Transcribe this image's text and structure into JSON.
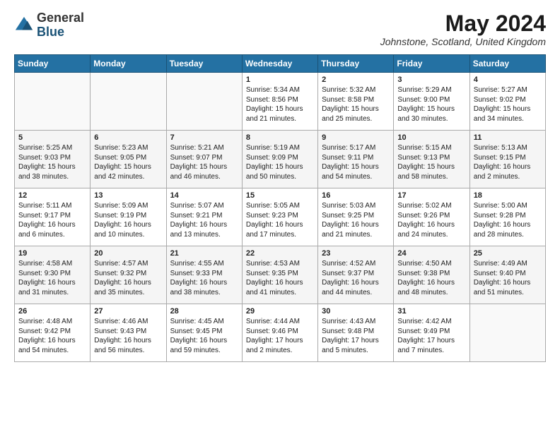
{
  "logo": {
    "general": "General",
    "blue": "Blue"
  },
  "header": {
    "month_year": "May 2024",
    "location": "Johnstone, Scotland, United Kingdom"
  },
  "days_of_week": [
    "Sunday",
    "Monday",
    "Tuesday",
    "Wednesday",
    "Thursday",
    "Friday",
    "Saturday"
  ],
  "weeks": [
    [
      {
        "day": "",
        "info": ""
      },
      {
        "day": "",
        "info": ""
      },
      {
        "day": "",
        "info": ""
      },
      {
        "day": "1",
        "info": "Sunrise: 5:34 AM\nSunset: 8:56 PM\nDaylight: 15 hours\nand 21 minutes."
      },
      {
        "day": "2",
        "info": "Sunrise: 5:32 AM\nSunset: 8:58 PM\nDaylight: 15 hours\nand 25 minutes."
      },
      {
        "day": "3",
        "info": "Sunrise: 5:29 AM\nSunset: 9:00 PM\nDaylight: 15 hours\nand 30 minutes."
      },
      {
        "day": "4",
        "info": "Sunrise: 5:27 AM\nSunset: 9:02 PM\nDaylight: 15 hours\nand 34 minutes."
      }
    ],
    [
      {
        "day": "5",
        "info": "Sunrise: 5:25 AM\nSunset: 9:03 PM\nDaylight: 15 hours\nand 38 minutes."
      },
      {
        "day": "6",
        "info": "Sunrise: 5:23 AM\nSunset: 9:05 PM\nDaylight: 15 hours\nand 42 minutes."
      },
      {
        "day": "7",
        "info": "Sunrise: 5:21 AM\nSunset: 9:07 PM\nDaylight: 15 hours\nand 46 minutes."
      },
      {
        "day": "8",
        "info": "Sunrise: 5:19 AM\nSunset: 9:09 PM\nDaylight: 15 hours\nand 50 minutes."
      },
      {
        "day": "9",
        "info": "Sunrise: 5:17 AM\nSunset: 9:11 PM\nDaylight: 15 hours\nand 54 minutes."
      },
      {
        "day": "10",
        "info": "Sunrise: 5:15 AM\nSunset: 9:13 PM\nDaylight: 15 hours\nand 58 minutes."
      },
      {
        "day": "11",
        "info": "Sunrise: 5:13 AM\nSunset: 9:15 PM\nDaylight: 16 hours\nand 2 minutes."
      }
    ],
    [
      {
        "day": "12",
        "info": "Sunrise: 5:11 AM\nSunset: 9:17 PM\nDaylight: 16 hours\nand 6 minutes."
      },
      {
        "day": "13",
        "info": "Sunrise: 5:09 AM\nSunset: 9:19 PM\nDaylight: 16 hours\nand 10 minutes."
      },
      {
        "day": "14",
        "info": "Sunrise: 5:07 AM\nSunset: 9:21 PM\nDaylight: 16 hours\nand 13 minutes."
      },
      {
        "day": "15",
        "info": "Sunrise: 5:05 AM\nSunset: 9:23 PM\nDaylight: 16 hours\nand 17 minutes."
      },
      {
        "day": "16",
        "info": "Sunrise: 5:03 AM\nSunset: 9:25 PM\nDaylight: 16 hours\nand 21 minutes."
      },
      {
        "day": "17",
        "info": "Sunrise: 5:02 AM\nSunset: 9:26 PM\nDaylight: 16 hours\nand 24 minutes."
      },
      {
        "day": "18",
        "info": "Sunrise: 5:00 AM\nSunset: 9:28 PM\nDaylight: 16 hours\nand 28 minutes."
      }
    ],
    [
      {
        "day": "19",
        "info": "Sunrise: 4:58 AM\nSunset: 9:30 PM\nDaylight: 16 hours\nand 31 minutes."
      },
      {
        "day": "20",
        "info": "Sunrise: 4:57 AM\nSunset: 9:32 PM\nDaylight: 16 hours\nand 35 minutes."
      },
      {
        "day": "21",
        "info": "Sunrise: 4:55 AM\nSunset: 9:33 PM\nDaylight: 16 hours\nand 38 minutes."
      },
      {
        "day": "22",
        "info": "Sunrise: 4:53 AM\nSunset: 9:35 PM\nDaylight: 16 hours\nand 41 minutes."
      },
      {
        "day": "23",
        "info": "Sunrise: 4:52 AM\nSunset: 9:37 PM\nDaylight: 16 hours\nand 44 minutes."
      },
      {
        "day": "24",
        "info": "Sunrise: 4:50 AM\nSunset: 9:38 PM\nDaylight: 16 hours\nand 48 minutes."
      },
      {
        "day": "25",
        "info": "Sunrise: 4:49 AM\nSunset: 9:40 PM\nDaylight: 16 hours\nand 51 minutes."
      }
    ],
    [
      {
        "day": "26",
        "info": "Sunrise: 4:48 AM\nSunset: 9:42 PM\nDaylight: 16 hours\nand 54 minutes."
      },
      {
        "day": "27",
        "info": "Sunrise: 4:46 AM\nSunset: 9:43 PM\nDaylight: 16 hours\nand 56 minutes."
      },
      {
        "day": "28",
        "info": "Sunrise: 4:45 AM\nSunset: 9:45 PM\nDaylight: 16 hours\nand 59 minutes."
      },
      {
        "day": "29",
        "info": "Sunrise: 4:44 AM\nSunset: 9:46 PM\nDaylight: 17 hours\nand 2 minutes."
      },
      {
        "day": "30",
        "info": "Sunrise: 4:43 AM\nSunset: 9:48 PM\nDaylight: 17 hours\nand 5 minutes."
      },
      {
        "day": "31",
        "info": "Sunrise: 4:42 AM\nSunset: 9:49 PM\nDaylight: 17 hours\nand 7 minutes."
      },
      {
        "day": "",
        "info": ""
      }
    ]
  ]
}
